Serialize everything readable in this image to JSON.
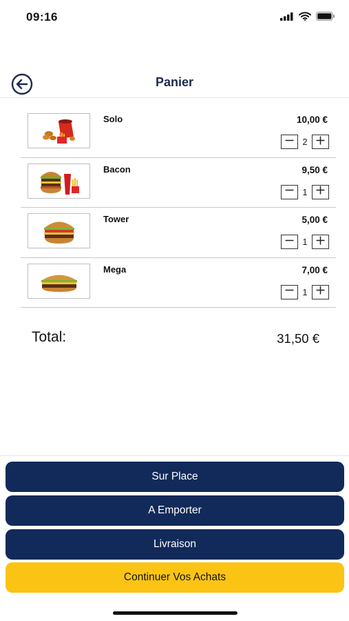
{
  "status_bar": {
    "time": "09:16",
    "icons": [
      "signal-icon",
      "wifi-icon",
      "battery-icon"
    ]
  },
  "header": {
    "title": "Panier",
    "back_icon": "back-arrow-circle-icon"
  },
  "cart": {
    "items": [
      {
        "name": "Solo",
        "price": "10,00 €",
        "quantity": "2",
        "image": "food-combo-image"
      },
      {
        "name": "Bacon",
        "price": "9,50 €",
        "quantity": "1",
        "image": "burger-soda-fries-image"
      },
      {
        "name": "Tower",
        "price": "5,00 €",
        "quantity": "1",
        "image": "burger-image"
      },
      {
        "name": "Mega",
        "price": "7,00 €",
        "quantity": "1",
        "image": "burger-image"
      }
    ],
    "total_label": "Total:",
    "total_value": "31,50 €"
  },
  "actions": {
    "sur_place": "Sur Place",
    "a_emporter": "A Emporter",
    "livraison": "Livraison",
    "continuer": "Continuer Vos Achats"
  },
  "colors": {
    "primary": "#122a5a",
    "accent": "#fbc415",
    "title": "#1d2b4f"
  }
}
